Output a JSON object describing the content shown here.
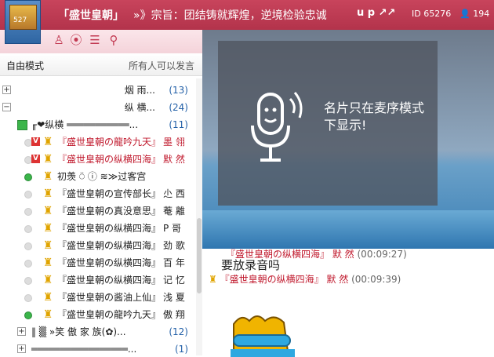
{
  "header": {
    "room_title": "「盛世皇朝」",
    "marquee": "»》宗旨：团结铸就辉煌，逆境检验忠诚",
    "right_text": "u p ↗↗",
    "room_id": "ID 65276",
    "online_count": "194",
    "logo_text": "527"
  },
  "mode": {
    "label": "自由模式",
    "desc": "所有人可以发言"
  },
  "channels": [
    {
      "name": "烟 雨...",
      "count": "(13)",
      "expander": "+"
    },
    {
      "name": "纵 横...",
      "count": "(24)",
      "expander": "−"
    }
  ],
  "sub_channel": {
    "name": "╓❤纵横 ═══════════...",
    "count": "(11)"
  },
  "users": [
    {
      "name": "『盛世皇朝の龍吟九天』",
      "nick": "墨 翎",
      "vip": "V",
      "red": true,
      "online": false
    },
    {
      "name": "『盛世皇朝の纵横四海』",
      "nick": "默 然",
      "vip": "V",
      "red": true,
      "online": false
    },
    {
      "name": "初羡 ⍥  ⓘ  ≋≫过客宫",
      "nick": "",
      "vip": "",
      "red": false,
      "online": true
    },
    {
      "name": "『盛世皇朝の宣传部长』",
      "nick": "尐 西",
      "vip": "",
      "red": false,
      "online": false
    },
    {
      "name": "『盛世皇朝の真没意思』",
      "nick": "菴 離",
      "vip": "",
      "red": false,
      "online": false
    },
    {
      "name": "『盛世皇朝の纵横四海』",
      "nick": "P 哥",
      "vip": "",
      "red": false,
      "online": false
    },
    {
      "name": "『盛世皇朝の纵横四海』",
      "nick": "劲 歌",
      "vip": "",
      "red": false,
      "online": false
    },
    {
      "name": "『盛世皇朝の纵横四海』",
      "nick": "百 年",
      "vip": "",
      "red": false,
      "online": false
    },
    {
      "name": "『盛世皇朝の纵横四海』",
      "nick": "记 忆",
      "vip": "",
      "red": false,
      "online": false
    },
    {
      "name": "『盛世皇朝の酱油上仙』",
      "nick": "浅 夏",
      "vip": "",
      "red": false,
      "online": false
    },
    {
      "name": "『盛世皇朝の龍吟九天』",
      "nick": "傲 翔",
      "vip": "",
      "red": false,
      "online": true
    }
  ],
  "bottom_channels": [
    {
      "name": "‖  ▒ »笑 傲 家 族(✿)...",
      "count": "(12)",
      "expander": "+"
    },
    {
      "name": "═════════════════...",
      "count": "(1)",
      "expander": "+"
    }
  ],
  "video": {
    "card_message": "名片只在麦序模式下显示!"
  },
  "chat": {
    "line1_user": "『盛世皇朝の纵横四海』",
    "line1_nick": "默 然",
    "line1_time": "(00:09:27)",
    "line1_msg": "要放录音吗",
    "line2_user": "『盛世皇朝の纵横四海』",
    "line2_nick": "默 然",
    "line2_time": "(00:09:39)"
  }
}
